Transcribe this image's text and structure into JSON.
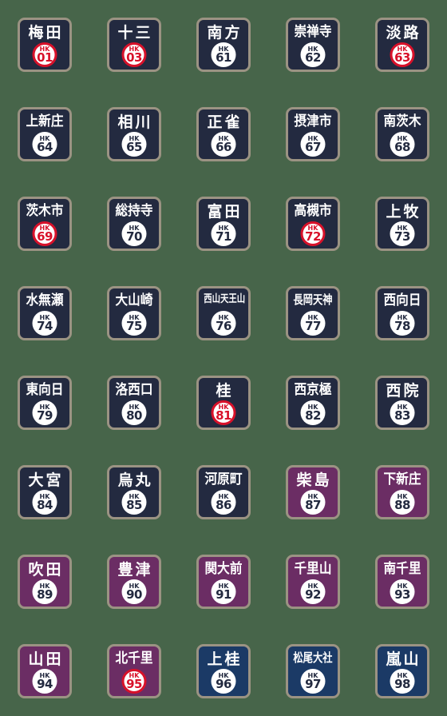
{
  "page": {
    "background_color": "#47654a",
    "title": "Hankyu station number signs",
    "columns": 5,
    "rows": 8
  },
  "palette": {
    "navy": "#232a40",
    "purple": "#6b2d64",
    "blue": "#1b3a66",
    "border": "#9b9383",
    "badge_red": "#d8112a",
    "badge_white": "#ffffff",
    "text_white": "#ffffff"
  },
  "prefix": "HK",
  "stations": [
    {
      "name": "梅田",
      "code": "01",
      "sign_color": "navy",
      "badge_style": "red"
    },
    {
      "name": "十三",
      "code": "03",
      "sign_color": "navy",
      "badge_style": "red"
    },
    {
      "name": "南方",
      "code": "61",
      "sign_color": "navy",
      "badge_style": "dark"
    },
    {
      "name": "崇禅寺",
      "code": "62",
      "sign_color": "navy",
      "badge_style": "dark"
    },
    {
      "name": "淡路",
      "code": "63",
      "sign_color": "navy",
      "badge_style": "red"
    },
    {
      "name": "上新庄",
      "code": "64",
      "sign_color": "navy",
      "badge_style": "dark"
    },
    {
      "name": "相川",
      "code": "65",
      "sign_color": "navy",
      "badge_style": "dark"
    },
    {
      "name": "正雀",
      "code": "66",
      "sign_color": "navy",
      "badge_style": "dark"
    },
    {
      "name": "摂津市",
      "code": "67",
      "sign_color": "navy",
      "badge_style": "dark"
    },
    {
      "name": "南茨木",
      "code": "68",
      "sign_color": "navy",
      "badge_style": "dark"
    },
    {
      "name": "茨木市",
      "code": "69",
      "sign_color": "navy",
      "badge_style": "red"
    },
    {
      "name": "総持寺",
      "code": "70",
      "sign_color": "navy",
      "badge_style": "dark"
    },
    {
      "name": "富田",
      "code": "71",
      "sign_color": "navy",
      "badge_style": "dark"
    },
    {
      "name": "高槻市",
      "code": "72",
      "sign_color": "navy",
      "badge_style": "red"
    },
    {
      "name": "上牧",
      "code": "73",
      "sign_color": "navy",
      "badge_style": "dark"
    },
    {
      "name": "水無瀬",
      "code": "74",
      "sign_color": "navy",
      "badge_style": "dark"
    },
    {
      "name": "大山崎",
      "code": "75",
      "sign_color": "navy",
      "badge_style": "dark"
    },
    {
      "name": "西山天王山",
      "code": "76",
      "sign_color": "navy",
      "badge_style": "dark"
    },
    {
      "name": "長岡天神",
      "code": "77",
      "sign_color": "navy",
      "badge_style": "dark"
    },
    {
      "name": "西向日",
      "code": "78",
      "sign_color": "navy",
      "badge_style": "dark"
    },
    {
      "name": "東向日",
      "code": "79",
      "sign_color": "navy",
      "badge_style": "dark"
    },
    {
      "name": "洛西口",
      "code": "80",
      "sign_color": "navy",
      "badge_style": "dark"
    },
    {
      "name": "桂",
      "code": "81",
      "sign_color": "navy",
      "badge_style": "red"
    },
    {
      "name": "西京極",
      "code": "82",
      "sign_color": "navy",
      "badge_style": "dark"
    },
    {
      "name": "西院",
      "code": "83",
      "sign_color": "navy",
      "badge_style": "dark"
    },
    {
      "name": "大宮",
      "code": "84",
      "sign_color": "navy",
      "badge_style": "dark"
    },
    {
      "name": "烏丸",
      "code": "85",
      "sign_color": "navy",
      "badge_style": "dark"
    },
    {
      "name": "河原町",
      "code": "86",
      "sign_color": "navy",
      "badge_style": "dark"
    },
    {
      "name": "柴島",
      "code": "87",
      "sign_color": "purple",
      "badge_style": "dark"
    },
    {
      "name": "下新庄",
      "code": "88",
      "sign_color": "purple",
      "badge_style": "dark"
    },
    {
      "name": "吹田",
      "code": "89",
      "sign_color": "purple",
      "badge_style": "dark"
    },
    {
      "name": "豊津",
      "code": "90",
      "sign_color": "purple",
      "badge_style": "dark"
    },
    {
      "name": "関大前",
      "code": "91",
      "sign_color": "purple",
      "badge_style": "dark"
    },
    {
      "name": "千里山",
      "code": "92",
      "sign_color": "purple",
      "badge_style": "dark"
    },
    {
      "name": "南千里",
      "code": "93",
      "sign_color": "purple",
      "badge_style": "dark"
    },
    {
      "name": "山田",
      "code": "94",
      "sign_color": "purple",
      "badge_style": "dark"
    },
    {
      "name": "北千里",
      "code": "95",
      "sign_color": "purple",
      "badge_style": "red"
    },
    {
      "name": "上桂",
      "code": "96",
      "sign_color": "blue",
      "badge_style": "dark"
    },
    {
      "name": "松尾大社",
      "code": "97",
      "sign_color": "blue",
      "badge_style": "dark"
    },
    {
      "name": "嵐山",
      "code": "98",
      "sign_color": "blue",
      "badge_style": "dark"
    }
  ]
}
